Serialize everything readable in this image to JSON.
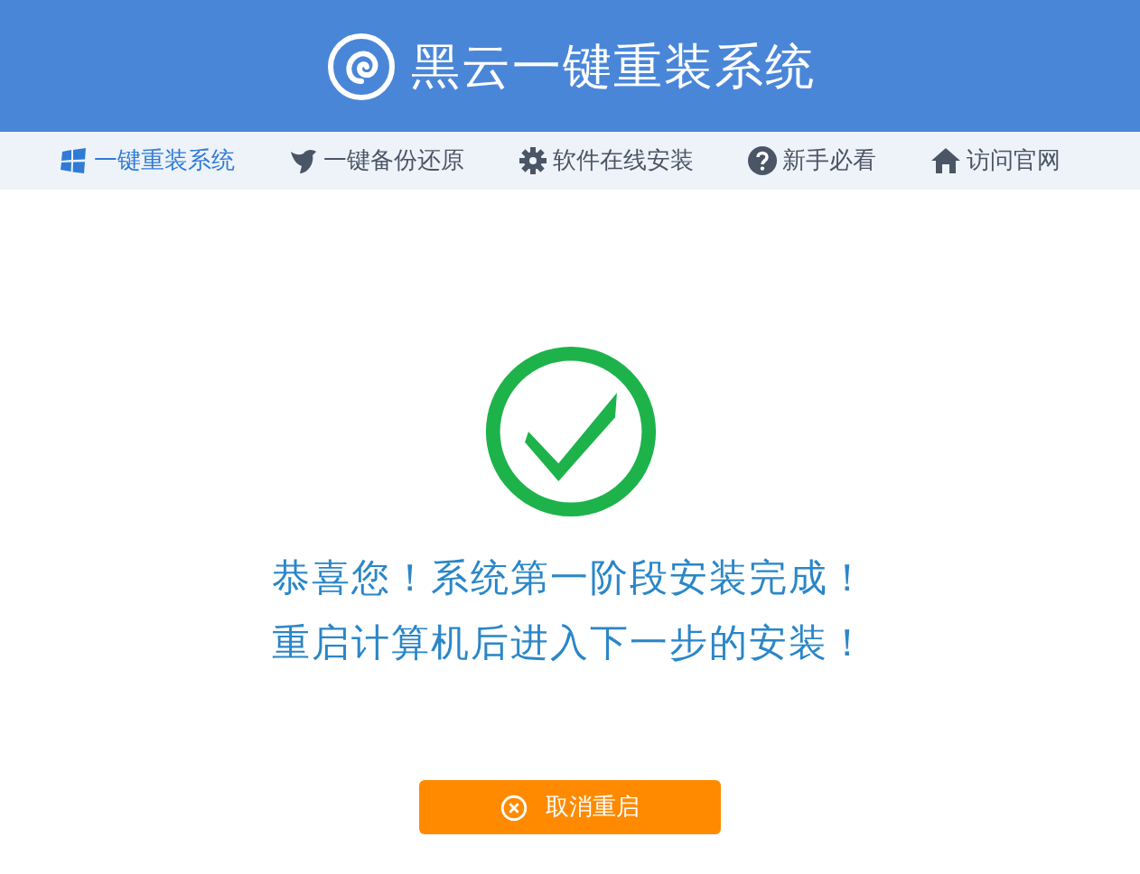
{
  "header": {
    "title": "黑云一键重装系统"
  },
  "nav": [
    {
      "label": "一键重装系统",
      "selected": true
    },
    {
      "label": "一键备份还原",
      "selected": false
    },
    {
      "label": "软件在线安装",
      "selected": false
    },
    {
      "label": "新手必看",
      "selected": false
    },
    {
      "label": "访问官网",
      "selected": false
    }
  ],
  "message": {
    "lines": [
      "恭喜您！系统第一阶段安装完成！",
      "重启计算机后进入下一步的安装！"
    ]
  },
  "button": {
    "label": "取消重启"
  }
}
